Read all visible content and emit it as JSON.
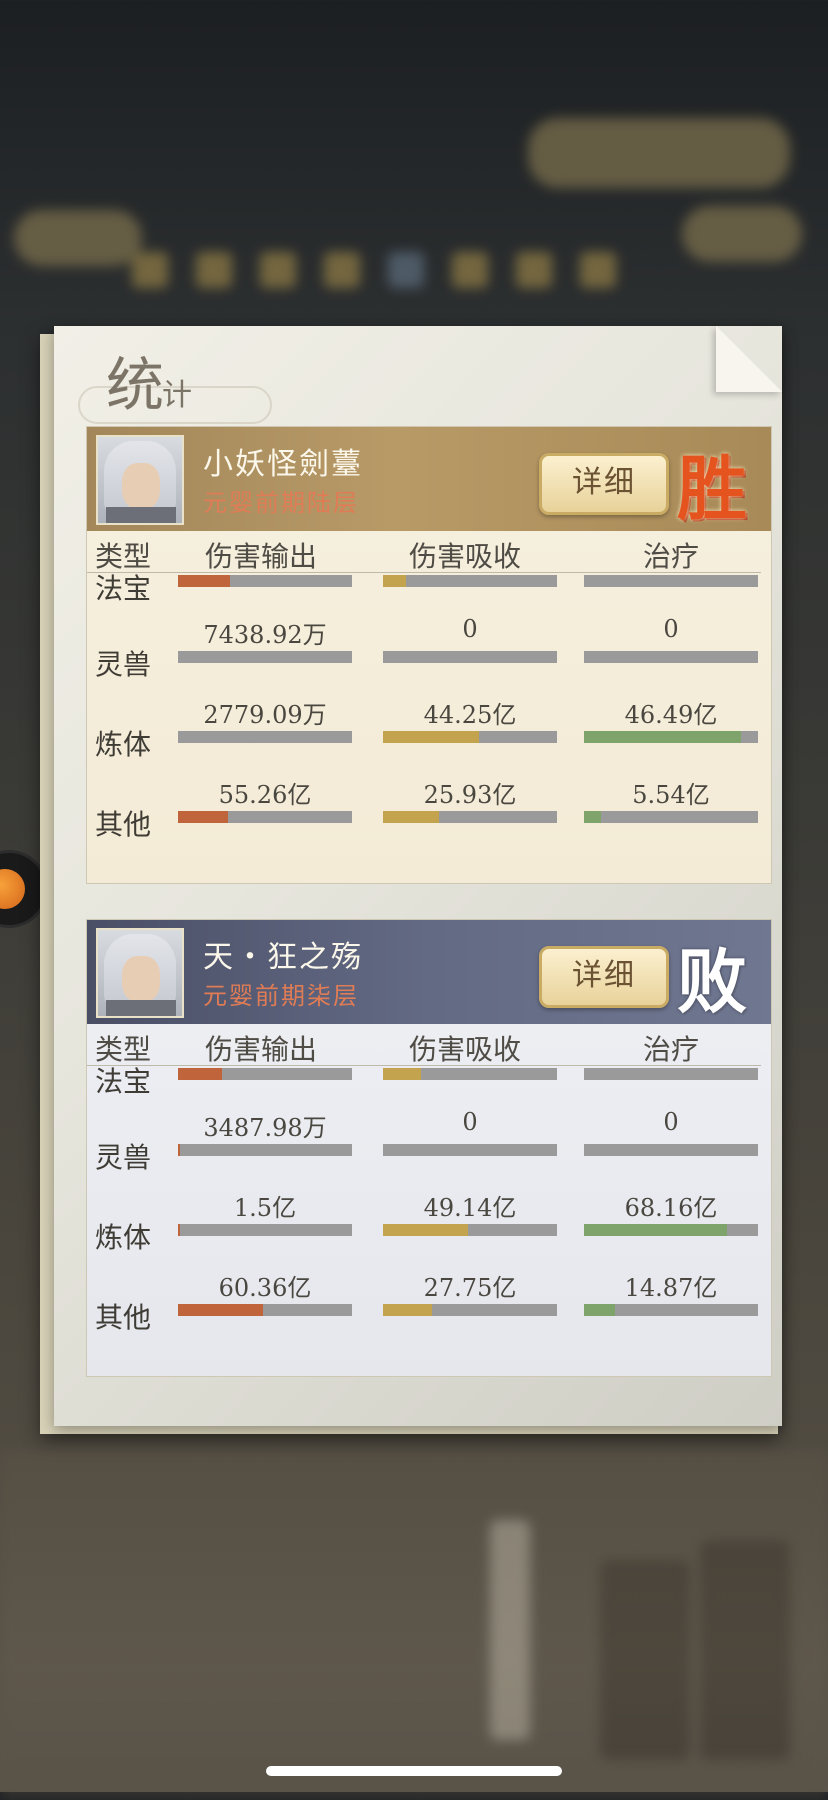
{
  "header": {
    "title_big": "统",
    "title_small": "计"
  },
  "columns": [
    "类型",
    "伤害输出",
    "伤害吸收",
    "治疗"
  ],
  "detail_label": "详细",
  "battles": [
    {
      "result": "胜",
      "player_name": "小妖怪劍薹",
      "player_rank": "元婴前期陆层",
      "rows": [
        {
          "type": "法宝",
          "damage": "",
          "damage_ratio": 0.3,
          "absorb": "",
          "absorb_ratio": 0.13,
          "heal": "",
          "heal_ratio": 0
        },
        {
          "type": "灵兽",
          "damage": "7438.92万",
          "damage_ratio": 0,
          "absorb": "0",
          "absorb_ratio": 0,
          "heal": "0",
          "heal_ratio": 0
        },
        {
          "type": "炼体",
          "damage": "2779.09万",
          "damage_ratio": 0,
          "absorb": "44.25亿",
          "absorb_ratio": 0.55,
          "heal": "46.49亿",
          "heal_ratio": 0.9
        },
        {
          "type": "其他",
          "damage": "55.26亿",
          "damage_ratio": 0.29,
          "absorb": "25.93亿",
          "absorb_ratio": 0.32,
          "heal": "5.54亿",
          "heal_ratio": 0.1
        }
      ]
    },
    {
      "result": "败",
      "player_name": "天・狂之殇",
      "player_rank": "元婴前期柒层",
      "rows": [
        {
          "type": "法宝",
          "damage": "",
          "damage_ratio": 0.25,
          "absorb": "",
          "absorb_ratio": 0.22,
          "heal": "",
          "heal_ratio": 0
        },
        {
          "type": "灵兽",
          "damage": "3487.98万",
          "damage_ratio": 0.01,
          "absorb": "0",
          "absorb_ratio": 0,
          "heal": "0",
          "heal_ratio": 0
        },
        {
          "type": "炼体",
          "damage": "1.5亿",
          "damage_ratio": 0.01,
          "absorb": "49.14亿",
          "absorb_ratio": 0.49,
          "heal": "68.16亿",
          "heal_ratio": 0.82
        },
        {
          "type": "其他",
          "damage": "60.36亿",
          "damage_ratio": 0.49,
          "absorb": "27.75亿",
          "absorb_ratio": 0.28,
          "heal": "14.87亿",
          "heal_ratio": 0.18
        }
      ]
    }
  ],
  "colors": {
    "damage": "#c0643b",
    "absorb": "#c4a34f",
    "heal": "#7fa46b",
    "win": "#e5541f"
  }
}
